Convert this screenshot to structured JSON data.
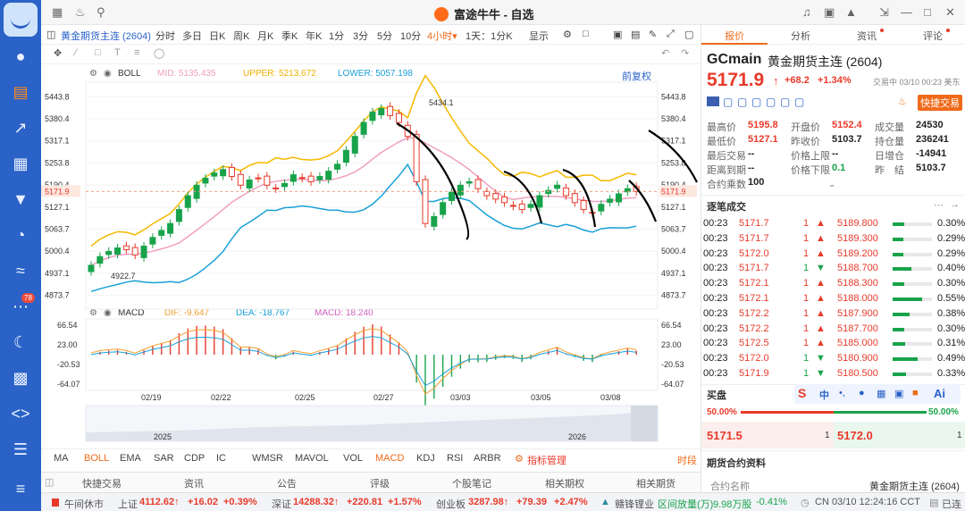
{
  "window": {
    "title": "富途牛牛 - 自选"
  },
  "nav": {
    "badge": "78",
    "icons": [
      "user-icon",
      "quote-icon",
      "trend-icon",
      "report-icon",
      "funnel-icon",
      "pie-icon",
      "zhuan-icon",
      "chat-icon",
      "moon-icon",
      "game-icon",
      "code-icon",
      "doc-icon",
      "menu-icon"
    ]
  },
  "toolbar": {
    "symbol": "黄金期货主连 (2604)",
    "periods": [
      "分时",
      "多日",
      "日K",
      "周K",
      "月K",
      "季K",
      "年K",
      "1分",
      "3分",
      "5分",
      "10分"
    ],
    "selected_period": "4小时",
    "period_suffix": "▾",
    "adjust": "1天：1分K",
    "display": "显示",
    "fuquan": "前复权"
  },
  "boll": {
    "name": "BOLL",
    "mid": "MID: 5135.435",
    "upper": "UPPER: 5213.672",
    "lower": "LOWER: 5057.198"
  },
  "macd": {
    "name": "MACD",
    "dif": "DIF: -9.647",
    "dea": "DEA: -18.767",
    "macd": "MACD: 18.240"
  },
  "chart_data": {
    "type": "candlestick",
    "price_axis": [
      "5443.8",
      "5380.4",
      "5317.1",
      "5253.8",
      "5190.4",
      "5127.1",
      "5063.7",
      "5000.4",
      "4937.1",
      "4873.7"
    ],
    "current_price_label": "5171.9",
    "high_marker": "5434.1",
    "low_marker": "4922.7",
    "macd_axis": [
      "66.54",
      "23.00",
      "-20.53",
      "-64.07"
    ],
    "dates": [
      "02/19",
      "02/22",
      "02/25",
      "02/27",
      "03/03",
      "03/05",
      "03/08"
    ],
    "overview_years": [
      "2025",
      "2026"
    ],
    "closes": [
      4960,
      4985,
      5000,
      5010,
      5005,
      4990,
      5015,
      5040,
      5060,
      5080,
      5120,
      5160,
      5190,
      5210,
      5225,
      5235,
      5215,
      5190,
      5205,
      5210,
      5190,
      5180,
      5195,
      5220,
      5210,
      5200,
      5215,
      5230,
      5250,
      5290,
      5330,
      5370,
      5400,
      5410,
      5390,
      5370,
      5330,
      5200,
      5080,
      5100,
      5140,
      5170,
      5190,
      5200,
      5180,
      5160,
      5150,
      5140,
      5130,
      5120,
      5135,
      5160,
      5175,
      5190,
      5160,
      5140,
      5120,
      5110,
      5135,
      5150,
      5165,
      5180,
      5172
    ]
  },
  "indicator_tabs": [
    "MA",
    "BOLL",
    "EMA",
    "SAR",
    "CDP",
    "IC",
    "WMSR",
    "MAVOL",
    "VOL",
    "MACD",
    "KDJ",
    "RSI",
    "ARBR"
  ],
  "indicator_manage": "指标管理",
  "time_label": "时段",
  "bottom_tabs": [
    "快捷交易",
    "资讯",
    "公告",
    "评级",
    "个股笔记",
    "相关期权",
    "相关期货"
  ],
  "right": {
    "tabs": [
      "报价",
      "分析",
      "资讯",
      "评论"
    ],
    "code": "GCmain",
    "name": "黄金期货主连 (2604)",
    "price": "5171.9",
    "arrow": "↑",
    "change": "+68.2",
    "change_pct": "+1.34%",
    "time": "交易中 03/10 00:23 美东",
    "quick_trade": "快捷交易",
    "stats": [
      {
        "label": "最高价",
        "value": "5195.8",
        "color": "red"
      },
      {
        "label": "开盘价",
        "value": "5152.4",
        "color": "red"
      },
      {
        "label": "成交量",
        "value": "24530",
        "color": "dark"
      },
      {
        "label": "最低价",
        "value": "5127.1",
        "color": "red"
      },
      {
        "label": "昨收价",
        "value": "5103.7",
        "color": "dark"
      },
      {
        "label": "持仓量",
        "value": "236241",
        "color": "dark"
      },
      {
        "label": "最后交易",
        "value": "--",
        "color": "dark"
      },
      {
        "label": "价格上限",
        "value": "--",
        "color": "dark"
      },
      {
        "label": "日增仓",
        "value": "-14941",
        "color": "dark"
      },
      {
        "label": "距离到期",
        "value": "--",
        "color": "dark"
      },
      {
        "label": "价格下限",
        "value": "0.1",
        "color": "green"
      },
      {
        "label": "昨　结",
        "value": "5103.7",
        "color": "dark"
      },
      {
        "label": "合约乘数",
        "value": "100",
        "color": "dark"
      }
    ],
    "trades_title": "逐笔成交",
    "trades": [
      {
        "t": "00:23",
        "p": "5171.7",
        "q": "1",
        "d": "▲",
        "p2": "5189.800",
        "pct": "0.30%"
      },
      {
        "t": "00:23",
        "p": "5171.7",
        "q": "1",
        "d": "▲",
        "p2": "5189.300",
        "pct": "0.29%"
      },
      {
        "t": "00:23",
        "p": "5172.0",
        "q": "1",
        "d": "▲",
        "p2": "5189.200",
        "pct": "0.29%"
      },
      {
        "t": "00:23",
        "p": "5171.7",
        "q": "1",
        "d": "▼",
        "p2": "5188.700",
        "pct": "0.40%"
      },
      {
        "t": "00:23",
        "p": "5172.1",
        "q": "1",
        "d": "▲",
        "p2": "5188.300",
        "pct": "0.30%"
      },
      {
        "t": "00:23",
        "p": "5172.1",
        "q": "1",
        "d": "▲",
        "p2": "5188.000",
        "pct": "0.55%"
      },
      {
        "t": "00:23",
        "p": "5172.2",
        "q": "1",
        "d": "▲",
        "p2": "5187.900",
        "pct": "0.38%"
      },
      {
        "t": "00:23",
        "p": "5172.2",
        "q": "1",
        "d": "▲",
        "p2": "5187.700",
        "pct": "0.30%"
      },
      {
        "t": "00:23",
        "p": "5172.5",
        "q": "1",
        "d": "▲",
        "p2": "5185.000",
        "pct": "0.31%"
      },
      {
        "t": "00:23",
        "p": "5172.0",
        "q": "1",
        "d": "▼",
        "p2": "5180.900",
        "pct": "0.49%"
      },
      {
        "t": "00:23",
        "p": "5171.9",
        "q": "1",
        "d": "▼",
        "p2": "5180.500",
        "pct": "0.33%"
      }
    ],
    "bidask_title": "买盘",
    "bid_pct": "50.00%",
    "ask_pct": "50.00%",
    "bid_price": "5171.5",
    "bid_qty": "1",
    "ask_price": "5172.0",
    "ask_qty": "1",
    "contract_title": "期货合约资料",
    "contract_label": "合约名称",
    "contract_value": "黄金期货主连 (2604)"
  },
  "status": {
    "market_state": "午间休市",
    "sh_name": "上证",
    "sh_val": "4112.62↑",
    "sh_chg": "+16.02",
    "sh_pct": "+0.39%",
    "sz_name": "深证",
    "sz_val": "14288.32↑",
    "sz_chg": "+220.81",
    "sz_pct": "+1.57%",
    "cy_name": "创业板",
    "cy_val": "3287.98↑",
    "cy_chg": "+79.39",
    "cy_pct": "+2.47%",
    "news": "赣锋锂业",
    "vol_label": "区间放量(万)",
    "vol_val": "9.98万股",
    "vol_pct": "-0.41%",
    "clock": "CN 03/10 12:24:16 CCT",
    "conn": "已连接"
  }
}
